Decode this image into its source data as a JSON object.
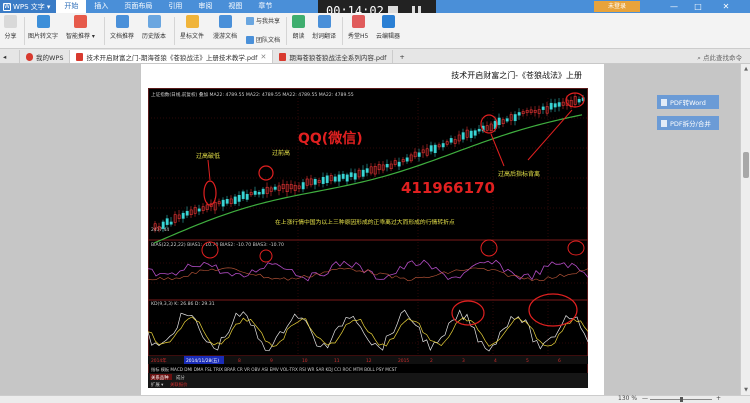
{
  "app": {
    "name": "WPS 文字",
    "menu": [
      "开始",
      "插入",
      "页面布局",
      "引用",
      "审阅",
      "视图",
      "章节"
    ],
    "login_label": "未登录",
    "window_controls": [
      "—",
      "□",
      "✕"
    ]
  },
  "recorder": {
    "time": "00:14:02"
  },
  "ribbon": {
    "tools": [
      {
        "label": "分享",
        "icon": "share-icon"
      },
      {
        "label": "图片转文字",
        "icon": "image-to-text-icon"
      },
      {
        "label": "智能推荐 ▾",
        "icon": "smart-recommend-icon"
      },
      {
        "label": "文档推荐",
        "icon": "doc-recommend-icon"
      },
      {
        "label": "历史版本",
        "icon": "history-icon"
      },
      {
        "label": "星标文件",
        "icon": "star-file-icon"
      },
      {
        "label": "漫游文档",
        "icon": "roaming-doc-icon"
      },
      {
        "label": "团队文档",
        "icon": "team-doc-icon"
      },
      {
        "label": "朗读",
        "icon": "read-aloud-icon"
      },
      {
        "label": "划词翻译",
        "icon": "translate-icon"
      },
      {
        "label": "秀堂H5",
        "icon": "h5-icon"
      },
      {
        "label": "云编辑器",
        "icon": "cloud-editor-icon"
      }
    ],
    "share_with": "与我共享"
  },
  "tabs": [
    {
      "label": "我的WPS",
      "active": false
    },
    {
      "label": "技术开启财富之门-期海苍狼《苍狼战法》上册技术教学.pdf",
      "active": true
    },
    {
      "label": "期海苍狼苍狼战法全系列内容.pdf",
      "active": false
    }
  ],
  "tab_search": "点此查找命令",
  "document": {
    "header": "技术开启财富之门-《苍狼战法》上册"
  },
  "side_buttons": [
    "PDF转Word",
    "PDF拆分/合并"
  ],
  "status": {
    "zoom": "130 %",
    "zoom_minus": "—",
    "zoom_plus": "+"
  },
  "chart_labels": {
    "ma_legend": "上证指数(日线,前复权) 叠加 MA22: 4789.55  MA22: 4789.55  MA22: 4789.55  MA22: 4789.55",
    "low_price": "2437.44",
    "ann_break": "过高破低",
    "ann_high": "过前高",
    "ann_qq": "QQ(微信)",
    "ann_number": "411966170",
    "ann_diverge": "过高后指标背离",
    "ann_note": "在上涨行情中国为以上三种原因形成的正乖离过大而形成的行情转折点",
    "bias_legend": "BIAS(22,22,22)  BIAS1: -10.70  BIAS2: -10.70  BIAS3: -10.70",
    "kd_legend": "KD(9,3,3)  K: 26.86  D: 29.31",
    "date_label": "2014/11/28(五)",
    "year_label": "2014年",
    "x_ticks": [
      "8",
      "9",
      "10",
      "11",
      "12",
      "2015",
      "2",
      "3",
      "4",
      "5",
      "6"
    ],
    "indicator_tabs": "指标 模板 MACD DMI DMA FSL TRIX BRAR CR VR OBV ASI EMV VOL-TRX RSI WR SAR KDJ CCI ROC MTM BOLL PSY MCST",
    "bottom_left": "扩展 ▾",
    "bottom_tab1": "关系品种",
    "bottom_tab2": "成分",
    "bottom_tab3": "关联报价"
  },
  "colors": {
    "menubar": "#4a8fd8",
    "annotation_red": "#e02020",
    "annotation_yellow": "#e8e44a",
    "ma_green": "#3fae3f",
    "side_button": "#6b9bd6"
  }
}
